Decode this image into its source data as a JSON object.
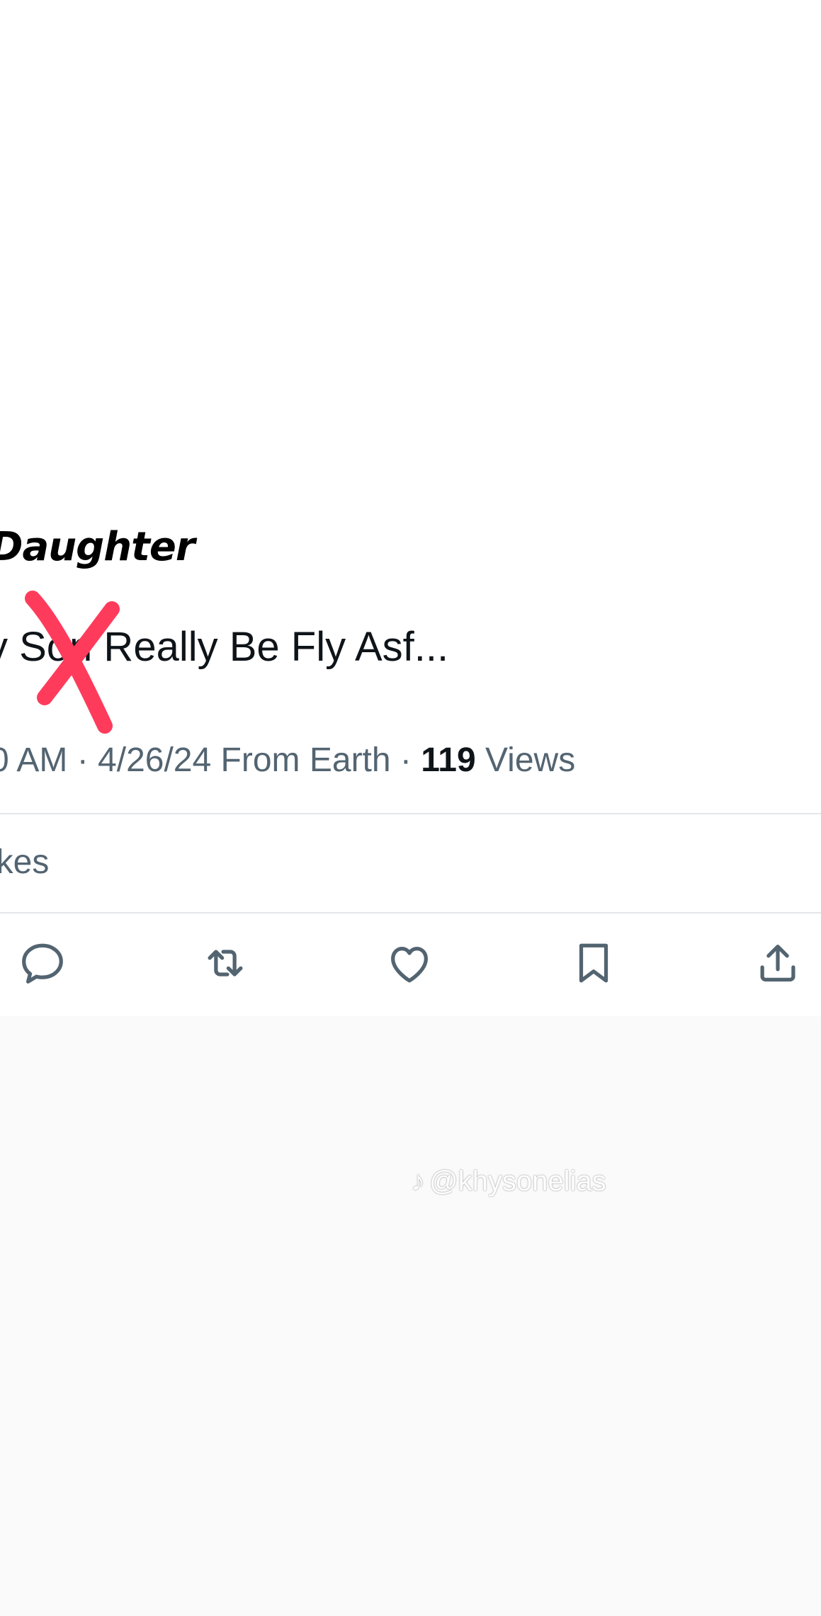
{
  "overlay": {
    "title": "Daughter"
  },
  "tweet": {
    "text": "y Son Really Be Fly Asf...",
    "meta": {
      "time": "0 AM",
      "separator1": " · ",
      "date": "4/26/24",
      "source": " From Earth",
      "separator2": " · ",
      "views_count": "119",
      "views_label": " Views"
    },
    "likes_label": "ikes"
  },
  "actions": [
    {
      "name": "reply",
      "icon": "reply-icon"
    },
    {
      "name": "retweet",
      "icon": "retweet-icon"
    },
    {
      "name": "like",
      "icon": "heart-icon"
    },
    {
      "name": "bookmark",
      "icon": "bookmark-icon"
    },
    {
      "name": "share",
      "icon": "share-icon"
    }
  ],
  "watermark": {
    "handle": "@khysonelias"
  },
  "colors": {
    "text": "#0f1419",
    "secondary": "#536471",
    "strike": "#ff3b5c",
    "divider": "#e3e7ea",
    "lower_background": "#fafafa"
  }
}
